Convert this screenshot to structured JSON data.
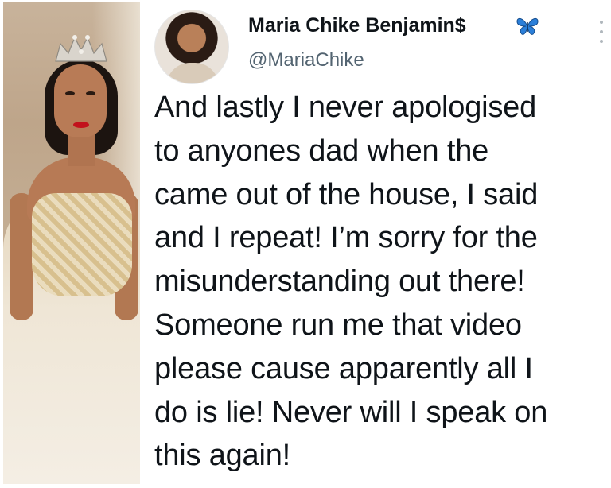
{
  "photo": {
    "icon": "woman-in-crown-photo"
  },
  "tweet": {
    "display_name": "Maria Chike Benjamin$",
    "handle": "@MariaChike",
    "badge_icon": "butterfly-icon",
    "badge_color": "#2b7fd9",
    "menu_icon": "more-vertical-icon",
    "lines": [
      "And lastly I never apologised",
      "to anyones dad when the",
      "came out of the house, I said",
      "and I repeat! I’m sorry for the",
      "misunderstanding out there!",
      "Someone run me that video",
      "please cause apparently all I",
      "do is lie! Never will I speak on",
      "this again!"
    ]
  }
}
